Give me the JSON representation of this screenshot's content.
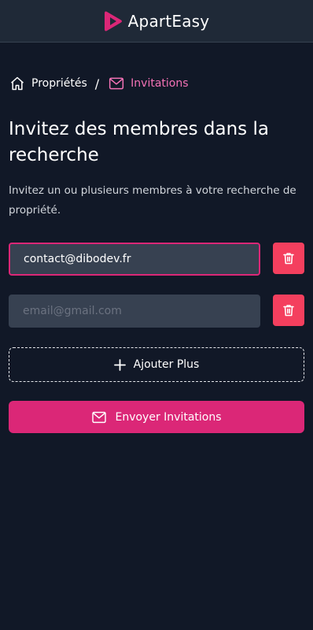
{
  "app": {
    "name": "ApartEasy",
    "brand_color": "#db2777"
  },
  "breadcrumb": {
    "home_label": "Propriétés",
    "separator": "/",
    "current_label": "Invitations",
    "current_color": "#f472b6"
  },
  "page": {
    "title": "Invitez des membres dans la recherche",
    "subtitle": "Invitez un ou plusieurs membres à votre recherche de propriété."
  },
  "form": {
    "emails": [
      {
        "value": "contact@dibodev.fr",
        "placeholder": "email@gmail.com",
        "focused": true
      },
      {
        "value": "",
        "placeholder": "email@gmail.com",
        "focused": false
      }
    ],
    "delete_icon": "trash-icon",
    "delete_color": "#f43f5e",
    "add_label": "Ajouter Plus",
    "add_icon": "plus-icon",
    "send_label": "Envoyer Invitations",
    "send_icon": "envelope-icon"
  }
}
